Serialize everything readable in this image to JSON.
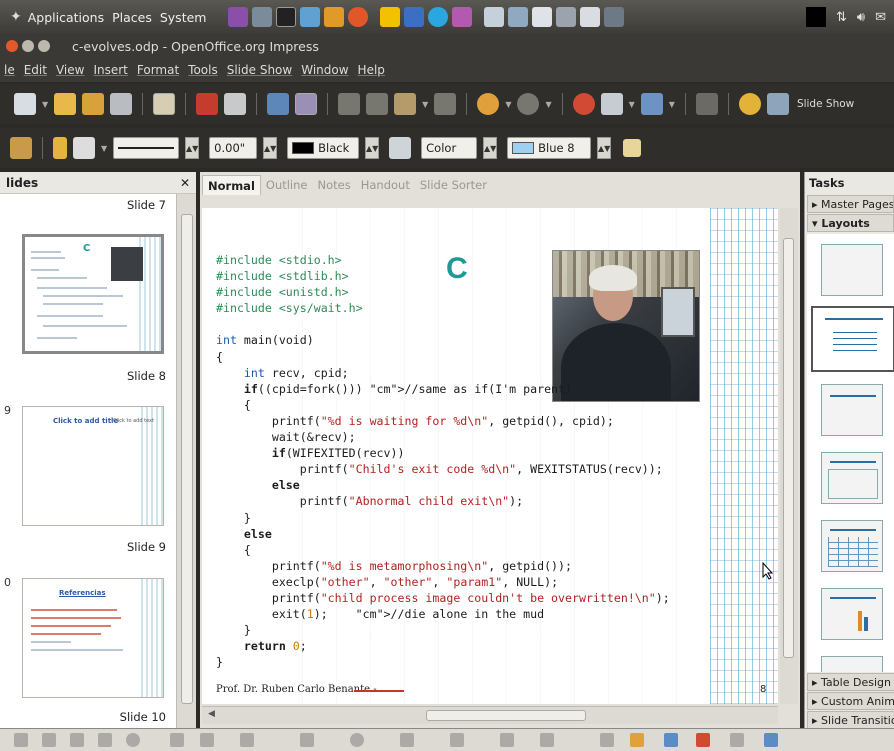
{
  "topbar": {
    "menu": [
      "Applications",
      "Places",
      "System"
    ],
    "tray_icons": [
      "network-icon",
      "volume-icon",
      "mail-icon"
    ]
  },
  "window": {
    "title": "c-evolves.odp - OpenOffice.org Impress"
  },
  "menubar": [
    "le",
    "Edit",
    "View",
    "Insert",
    "Format",
    "Tools",
    "Slide Show",
    "Window",
    "Help"
  ],
  "toolbar": {
    "slide_show_label": "Slide Show"
  },
  "formatbar": {
    "line_width": "0.00\"",
    "line_color": "Black",
    "area_style": "Color",
    "area_color": "Blue 8",
    "line_color_swatch": "#000000",
    "area_color_swatch": "#9fd0ef"
  },
  "slides_pane": {
    "title": "lides",
    "items": [
      {
        "label": "Slide 7",
        "num": ""
      },
      {
        "label": "Slide 8",
        "num": ""
      },
      {
        "label": "Slide 9",
        "num": "9"
      },
      {
        "label": "Slide 10",
        "num": "0"
      }
    ],
    "slide8_thumb_title": "Click to add title",
    "slide8_thumb_sub": "Click to add text",
    "slide10_thumb_title": "Referencias"
  },
  "view_tabs": [
    "Normal",
    "Outline",
    "Notes",
    "Handout",
    "Slide Sorter"
  ],
  "slide": {
    "big_letter": "C",
    "code_lines": [
      "#include <stdio.h>",
      "#include <stdlib.h>",
      "#include <unistd.h>",
      "#include <sys/wait.h>",
      "",
      "int main(void)",
      "{",
      "    int recv, cpid;",
      "    if((cpid=fork())) //same as if(I'm parent)",
      "    {",
      "        printf(\"%d is waiting for %d\\n\", getpid(), cpid);",
      "        wait(&recv);",
      "        if(WIFEXITED(recv))",
      "            printf(\"Child's exit code %d\\n\", WEXITSTATUS(recv));",
      "        else",
      "            printf(\"Abnormal child exit\\n\");",
      "    }",
      "    else",
      "    {",
      "        printf(\"%d is metamorphosing\\n\", getpid());",
      "        execlp(\"other\", \"other\", \"param1\", NULL);",
      "        printf(\"child process image couldn't be overwritten!\\n\");",
      "        exit(1);    //die alone in the mud",
      "    }",
      "    return 0;",
      "}"
    ],
    "footer_text": "Prof. Dr. Ruben Carlo Benante -",
    "page_number": "8"
  },
  "tasks_pane": {
    "title": "Tasks",
    "sections_top": [
      "Master Pages",
      "Layouts"
    ],
    "sections_bottom": [
      "Table Design",
      "Custom Animation",
      "Slide Transition"
    ]
  }
}
